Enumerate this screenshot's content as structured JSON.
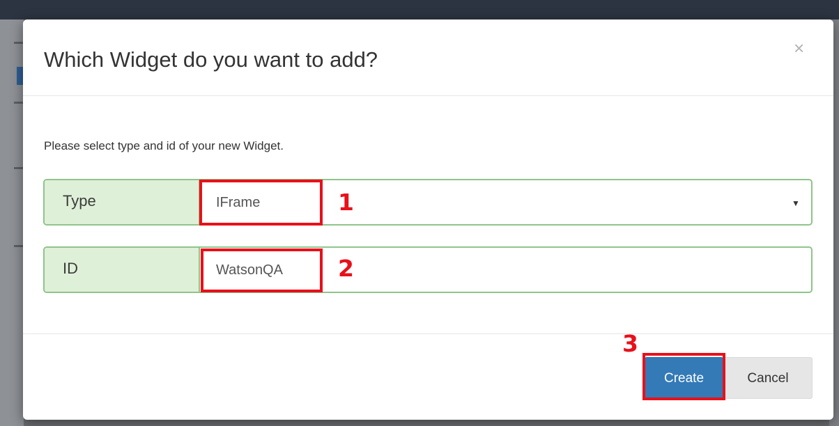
{
  "dialog": {
    "title": "Which Widget do you want to add?",
    "close_glyph": "×",
    "intro_text": "Please select type and id of your new Widget."
  },
  "type_field": {
    "label": "Type",
    "value": "IFrame",
    "caret": "▼"
  },
  "id_field": {
    "label": "ID",
    "value": "WatsonQA"
  },
  "buttons": {
    "create": "Create",
    "cancel": "Cancel"
  },
  "annotations": {
    "step1": "1",
    "step2": "2",
    "step3": "3",
    "highlight_color": "#e8101a"
  },
  "colors": {
    "primary": "#337ab7",
    "addon_bg": "#dff0d8",
    "addon_border": "#8fc48a"
  }
}
